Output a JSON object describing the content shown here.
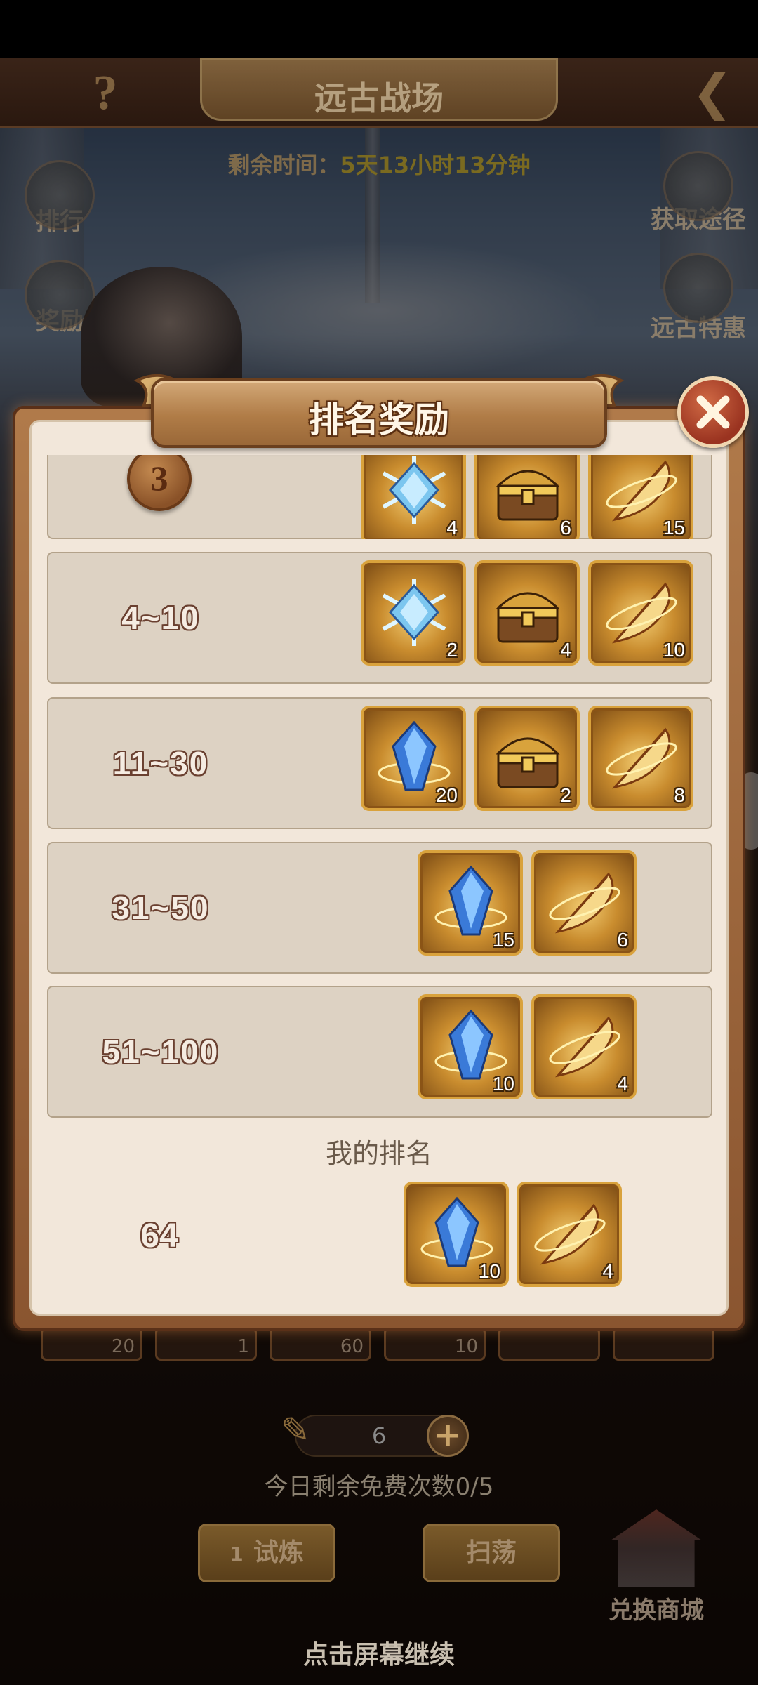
{
  "screen": {
    "title": "远古战场",
    "timer_label": "剩余时间：",
    "timer_value": "5天13小时13分钟",
    "side_left": [
      "排行",
      "奖励"
    ],
    "side_right": [
      "获取途径",
      "远古特惠"
    ],
    "bottom_slot_counts": [
      "20",
      "1",
      "60",
      "10",
      "",
      ""
    ],
    "ticket_count": "6",
    "free_times": "今日剩余免费次数0/5",
    "trial_button": "试炼",
    "trial_cost": "1",
    "sweep_button": "扫荡",
    "shop_label": "兑换商城",
    "continue_hint": "点击屏幕继续"
  },
  "dialog": {
    "title": "排名奖励",
    "rows": [
      {
        "rank": "3",
        "items": [
          {
            "icon": "snowflake-crystal-icon",
            "count": "4"
          },
          {
            "icon": "treasure-chest-icon",
            "count": "6"
          },
          {
            "icon": "golden-feather-icon",
            "count": "15"
          }
        ]
      },
      {
        "rank": "4~10",
        "items": [
          {
            "icon": "snowflake-crystal-icon",
            "count": "2"
          },
          {
            "icon": "treasure-chest-icon",
            "count": "4"
          },
          {
            "icon": "golden-feather-icon",
            "count": "10"
          }
        ]
      },
      {
        "rank": "11~30",
        "items": [
          {
            "icon": "blue-gem-icon",
            "count": "20"
          },
          {
            "icon": "treasure-chest-icon",
            "count": "2"
          },
          {
            "icon": "golden-feather-icon",
            "count": "8"
          }
        ]
      },
      {
        "rank": "31~50",
        "items": [
          {
            "icon": "blue-gem-icon",
            "count": "15"
          },
          {
            "icon": "golden-feather-icon",
            "count": "6"
          }
        ]
      },
      {
        "rank": "51~100",
        "items": [
          {
            "icon": "blue-gem-icon",
            "count": "10"
          },
          {
            "icon": "golden-feather-icon",
            "count": "4"
          }
        ]
      }
    ],
    "my_rank_label": "我的排名",
    "my_rank": "64",
    "my_rewards": [
      {
        "icon": "blue-gem-icon",
        "count": "10"
      },
      {
        "icon": "golden-feather-icon",
        "count": "4"
      }
    ]
  },
  "colors": {
    "dialog_bg": "#f2e7da",
    "row_bg": "#ddd2c3",
    "item_gold": "#d9a23c",
    "close_red": "#9a3320"
  }
}
